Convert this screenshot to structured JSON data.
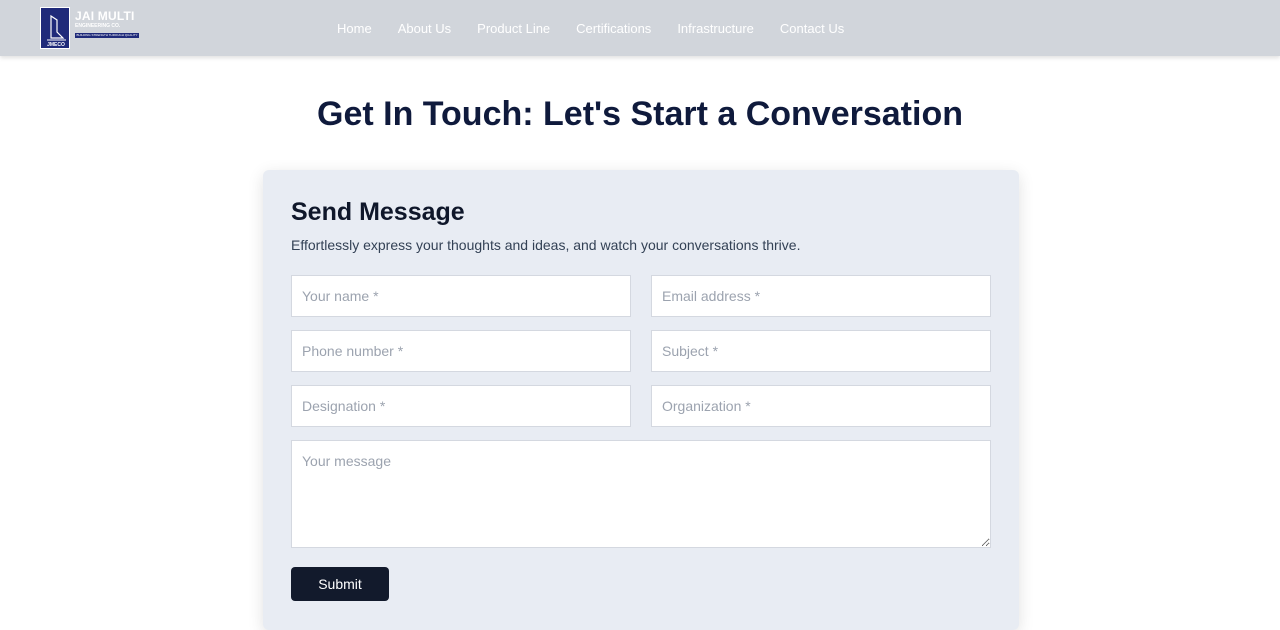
{
  "brand": {
    "name": "JAI MULTI",
    "subtitle": "ENGINEERING CO.",
    "tagline": "BUILDING STRENGTH THROUGH QUALITY",
    "mark_text": "JMECO"
  },
  "nav": {
    "items": [
      {
        "label": "Home"
      },
      {
        "label": "About Us"
      },
      {
        "label": "Product Line"
      },
      {
        "label": "Certifications"
      },
      {
        "label": "Infrastructure"
      },
      {
        "label": "Contact Us"
      }
    ]
  },
  "page": {
    "title": "Get In Touch: Let's Start a Conversation"
  },
  "form": {
    "title": "Send Message",
    "description": "Effortlessly express your thoughts and ideas, and watch your conversations thrive.",
    "fields": {
      "name": {
        "placeholder": "Your name *",
        "value": ""
      },
      "email": {
        "placeholder": "Email address *",
        "value": ""
      },
      "phone": {
        "placeholder": "Phone number *",
        "value": ""
      },
      "subject": {
        "placeholder": "Subject *",
        "value": ""
      },
      "designation": {
        "placeholder": "Designation *",
        "value": ""
      },
      "organization": {
        "placeholder": "Organization *",
        "value": ""
      },
      "message": {
        "placeholder": "Your message",
        "value": ""
      }
    },
    "submit_label": "Submit"
  },
  "colors": {
    "navbar_bg": "#d1d5db",
    "brand_blue": "#1f2a7a",
    "title_navy": "#0f1a3c",
    "card_bg": "#e8ecf3",
    "button_bg": "#121a2c"
  },
  "icons": {
    "logo": "jmeco-logo-icon",
    "resize": "resize-handle-icon"
  }
}
